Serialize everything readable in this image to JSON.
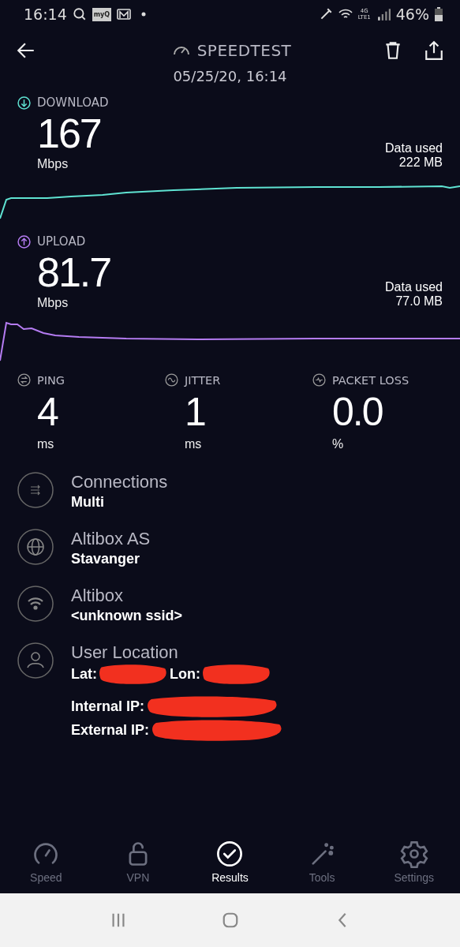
{
  "status_bar": {
    "time": "16:14",
    "app_badge": "myQ",
    "network": "4G",
    "network_sub": "LTE1",
    "battery": "46%"
  },
  "header": {
    "title": "SPEEDTEST",
    "date": "05/25/20, 16:14"
  },
  "tests": [
    {
      "kind": "download",
      "label": "DOWNLOAD",
      "value": "167",
      "unit": "Mbps",
      "data_used_label": "Data used",
      "data_used": "222 MB",
      "color": "#5fe3d2"
    },
    {
      "kind": "upload",
      "label": "UPLOAD",
      "value": "81.7",
      "unit": "Mbps",
      "data_used_label": "Data used",
      "data_used": "77.0 MB",
      "color": "#b57cf2"
    }
  ],
  "stats": [
    {
      "kind": "ping",
      "label": "PING",
      "value": "4",
      "unit": "ms"
    },
    {
      "kind": "jitter",
      "label": "JITTER",
      "value": "1",
      "unit": "ms"
    },
    {
      "kind": "loss",
      "label": "PACKET LOSS",
      "value": "0.0",
      "unit": "%"
    }
  ],
  "details": [
    {
      "kind": "connections",
      "title": "Connections",
      "value": "Multi"
    },
    {
      "kind": "globe",
      "title": "Altibox AS",
      "value": "Stavanger"
    },
    {
      "kind": "wifi",
      "title": "Altibox",
      "value": "<unknown ssid>"
    },
    {
      "kind": "user",
      "title": "User Location",
      "lines": [
        [
          "Lat:",
          "Lon:"
        ],
        [
          "Internal IP:"
        ],
        [
          "External IP:"
        ]
      ]
    }
  ],
  "nav": [
    {
      "kind": "speed",
      "label": "Speed",
      "selected": false
    },
    {
      "kind": "vpn",
      "label": "VPN",
      "selected": false
    },
    {
      "kind": "results",
      "label": "Results",
      "selected": true
    },
    {
      "kind": "tools",
      "label": "Tools",
      "selected": false
    },
    {
      "kind": "settings",
      "label": "Settings",
      "selected": false
    }
  ]
}
